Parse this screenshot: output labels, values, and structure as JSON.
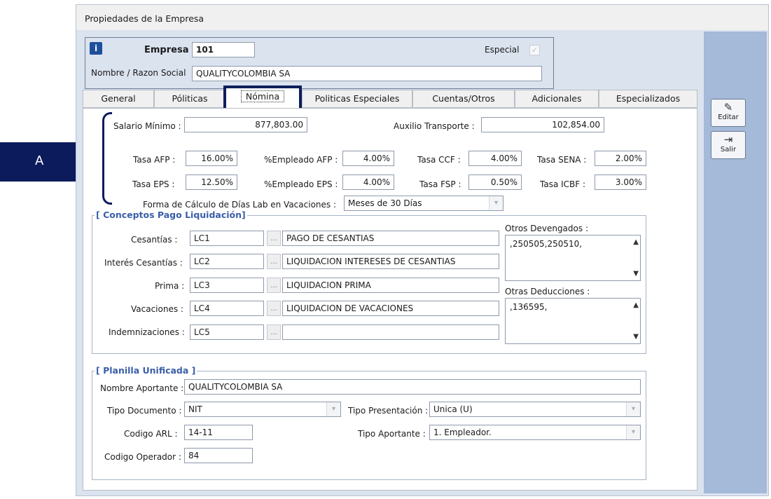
{
  "window": {
    "title": "Propiedades de la Empresa"
  },
  "header": {
    "empresa_label": "Empresa",
    "empresa_value": "101",
    "especial_label": "Especial",
    "especial_check": "✓",
    "nombre_label": "Nombre / Razon Social",
    "nombre_value": "QUALITYCOLOMBIA SA"
  },
  "tabs": [
    "General",
    "Póliticas",
    "Nómina",
    "Politicas Especiales",
    "Cuentas/Otros",
    "Adicionales",
    "Especializados"
  ],
  "active_tab": "Nómina",
  "nomina": {
    "salario_minimo_label": "Salario Mínimo :",
    "salario_minimo": "877,803.00",
    "auxilio_label": "Auxilio Transporte :",
    "auxilio": "102,854.00",
    "tasa_afp_label": "Tasa AFP :",
    "tasa_afp": "16.00%",
    "empleado_afp_label": "%Empleado AFP :",
    "empleado_afp": "4.00%",
    "tasa_ccf_label": "Tasa CCF :",
    "tasa_ccf": "4.00%",
    "tasa_sena_label": "Tasa SENA :",
    "tasa_sena": "2.00%",
    "tasa_eps_label": "Tasa EPS :",
    "tasa_eps": "12.50%",
    "empleado_eps_label": "%Empleado EPS :",
    "empleado_eps": "4.00%",
    "tasa_fsp_label": "Tasa FSP :",
    "tasa_fsp": "0.50%",
    "tasa_icbf_label": "Tasa ICBF :",
    "tasa_icbf": "3.00%",
    "forma_calculo_label": "Forma de Cálculo de Días Lab en Vacaciones :",
    "forma_calculo": "Meses de 30 Días"
  },
  "conceptos": {
    "title": "[ Conceptos Pago Liquidación]",
    "browse_label": "...",
    "rows": [
      {
        "label": "Cesantías :",
        "code": "LC1",
        "desc": "PAGO DE CESANTIAS"
      },
      {
        "label": "Interés Cesantías :",
        "code": "LC2",
        "desc": "LIQUIDACION INTERESES DE CESANTIAS"
      },
      {
        "label": "Prima :",
        "code": "LC3",
        "desc": "LIQUIDACION PRIMA"
      },
      {
        "label": "Vacaciones :",
        "code": "LC4",
        "desc": "LIQUIDACION DE VACACIONES"
      },
      {
        "label": "Indemnizaciones :",
        "code": "LC5",
        "desc": ""
      }
    ],
    "otros_devengados_label": "Otros Devengados :",
    "otros_devengados": ",250505,250510,",
    "otras_deducciones_label": "Otras Deducciones :",
    "otras_deducciones": ",136595,"
  },
  "planilla": {
    "title": "[ Planilla Unificada ]",
    "nombre_aportante_label": "Nombre Aportante :",
    "nombre_aportante": "QUALITYCOLOMBIA SA",
    "tipo_documento_label": "Tipo Documento :",
    "tipo_documento": "NIT",
    "tipo_presentacion_label": "Tipo Presentación :",
    "tipo_presentacion": "Unica (U)",
    "codigo_arl_label": "Codigo ARL :",
    "codigo_arl": "14-11",
    "tipo_aportante_label": "Tipo Aportante :",
    "tipo_aportante": "1. Empleador.",
    "codigo_operador_label": "Codigo Operador :",
    "codigo_operador": "84"
  },
  "sidebar": {
    "editar_label": "Editar",
    "salir_label": "Salir"
  },
  "callout": {
    "label": "A"
  },
  "icons": {
    "info": "info-icon",
    "edit": "edit-icon",
    "exit": "exit-icon",
    "dropdown": "chevron-down-icon"
  },
  "colors": {
    "frame_bg": "#dbe3ef",
    "side_bg": "#a5b9d8",
    "group_title": "#3a5ea8",
    "callout": "#0c1b5c"
  }
}
